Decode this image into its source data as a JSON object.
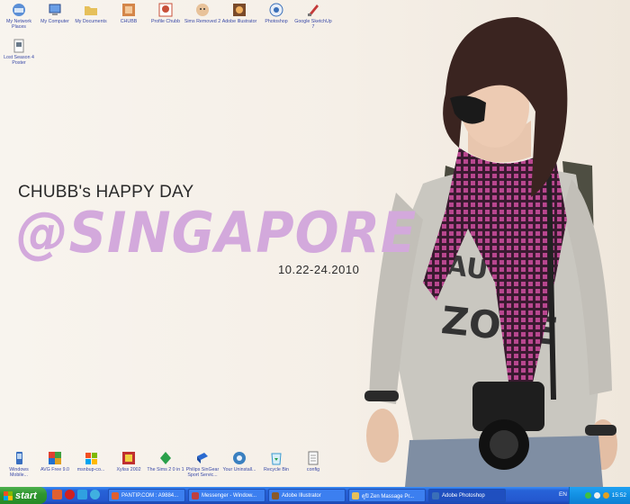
{
  "wallpaper": {
    "heading": "CHUBB's HAPPY DAY",
    "big_text": "@SINGAPORE",
    "date_range": "10.22-24.2010"
  },
  "desktop_icons_top": [
    {
      "label": "My Network Places",
      "icon": "network-icon",
      "color": "#5b8fd6"
    },
    {
      "label": "My Computer",
      "icon": "computer-icon",
      "color": "#6a9ee6"
    },
    {
      "label": "My Documents",
      "icon": "folder-icon",
      "color": "#e6c05a"
    },
    {
      "label": "CHUBB",
      "icon": "folder-icon",
      "color": "#d4864a"
    },
    {
      "label": "Profile Chubb",
      "icon": "profile-icon",
      "color": "#c8503a"
    },
    {
      "label": "Sims Removed 2",
      "icon": "game-icon",
      "color": "#a36a3a"
    },
    {
      "label": "Adobe Illustrator",
      "icon": "illustrator-icon",
      "color": "#7a4a2a"
    },
    {
      "label": "Photoshop",
      "icon": "photoshop-icon",
      "color": "#3a6fb8"
    },
    {
      "label": "Google SketchUp 7",
      "icon": "sketchup-icon",
      "color": "#c43a3a"
    }
  ],
  "desktop_icons_second_row": [
    {
      "label": "Lost Season 4 Poster",
      "icon": "image-file-icon",
      "color": "#8a8a8a"
    }
  ],
  "desktop_icons_bottom": [
    {
      "label": "Windows Mobile...",
      "icon": "phone-icon",
      "color": "#3a6fc0"
    },
    {
      "label": "AVG Free 9.0",
      "icon": "antivirus-icon",
      "color": "#e0a020"
    },
    {
      "label": "msnbup-co...",
      "icon": "windows-icon",
      "color": "#2e8bd8"
    },
    {
      "label": "Xyliss 2002",
      "icon": "game-icon",
      "color": "#c03030"
    },
    {
      "label": "The Sims 2 0 in 1",
      "icon": "sims-icon",
      "color": "#2aa04a"
    },
    {
      "label": "Philips SinGear Sport Servic...",
      "icon": "device-icon",
      "color": "#2a6ad0"
    },
    {
      "label": "Your Uninstall...",
      "icon": "uninstall-icon",
      "color": "#3a80c0"
    },
    {
      "label": "Recycle Bin",
      "icon": "recycle-bin-icon",
      "color": "#3a9ad0"
    },
    {
      "label": "config",
      "icon": "text-file-icon",
      "color": "#7a7a7a"
    }
  ],
  "taskbar": {
    "start_label": "start",
    "quick_launch": [
      {
        "icon": "browser-icon",
        "color": "#e06030"
      },
      {
        "icon": "opera-icon",
        "color": "#d02020"
      },
      {
        "icon": "messenger-icon",
        "color": "#30a0e0"
      },
      {
        "icon": "media-icon",
        "color": "#40b0e0"
      }
    ],
    "tasks": [
      {
        "label": "PANTIP.COM : A9884...",
        "icon": "browser-icon",
        "color": "#e06030"
      },
      {
        "label": "Messenger - Window...",
        "icon": "messenger-icon",
        "color": "#c04040"
      },
      {
        "label": "Adobe Illustrator",
        "icon": "illustrator-icon",
        "color": "#8a5a2a"
      },
      {
        "label": "ดูปิ Zen Massage Pr...",
        "icon": "folder-icon",
        "color": "#e6c05a"
      },
      {
        "label": "Adobe Photoshop",
        "icon": "photoshop-icon",
        "color": "#3a6fb8"
      }
    ],
    "language": "EN",
    "clock": "15:52"
  }
}
